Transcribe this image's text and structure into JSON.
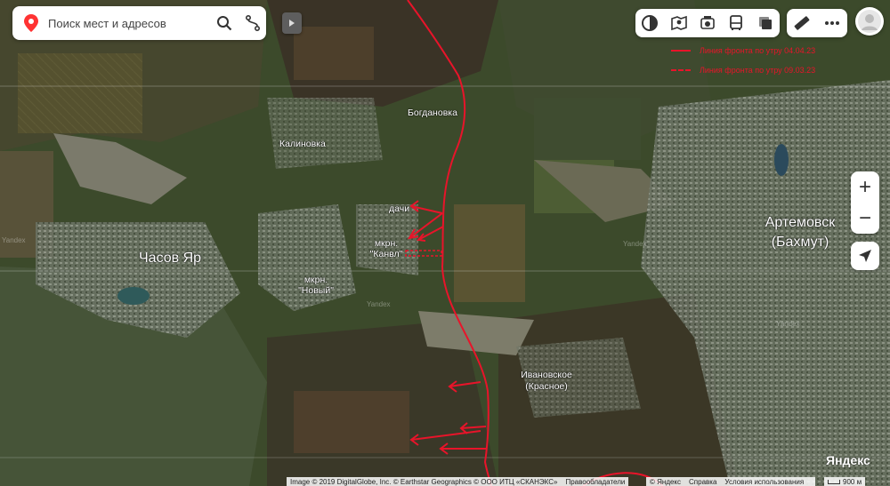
{
  "search": {
    "placeholder": "Поиск мест и адресов"
  },
  "icons": {
    "pin": "map-pin-icon",
    "search": "search-icon",
    "route": "route-icon",
    "collapse": "play-triangle-icon",
    "layers": "layers-icon",
    "panorama": "panorama-icon",
    "transport": "transport-icon",
    "bus": "bus-icon",
    "traffic": "traffic-icon",
    "ruler": "ruler-icon",
    "more": "more-icon",
    "avatar": "user-avatar-icon",
    "zoom_in": "plus-icon",
    "zoom_out": "minus-icon",
    "locate": "locate-arrow-icon"
  },
  "zoom": {
    "in_label": "+",
    "out_label": "−"
  },
  "legend": {
    "solid": "Линия фронта по утру 04.04.23",
    "dashed": "Линия фронта по утру 09.03.23"
  },
  "places": {
    "bogdanovka": "Богдановка",
    "kalinovka": "Калиновка",
    "dachi": "дачи",
    "kanal_1": "мкрн.",
    "kanal_2": "\"Канвл\"",
    "chasov_yar": "Часов Яр",
    "novy_1": "мкрн.",
    "novy_2": "\"Новый\"",
    "artemovsk_1": "Артемовск",
    "artemovsk_2": "(Бахмут)",
    "ivanovskoe_1": "Ивановское",
    "ivanovskoe_2": "(Красное)"
  },
  "watermarks": {
    "w1": "Yandex",
    "w2": "Yandex",
    "w3": "Yandex",
    "w4": "Yandex"
  },
  "brand": "Яндекс",
  "footer": {
    "copyright": "Image © 2019 DigitalGlobe, Inc. © Earthstar Geographics © ООО ИТЦ «СКАНЭКС»",
    "rights": "Правообладатели",
    "yandex": "© Яндекс",
    "help": "Справка",
    "terms": "Условия использования",
    "scale": "900 м"
  },
  "colors": {
    "front_line": "#e8142a",
    "pin": "#f33",
    "terrain_dark": "#3d4a2e",
    "terrain_field": "#5c5a3e",
    "urban": "#8a8f84"
  }
}
